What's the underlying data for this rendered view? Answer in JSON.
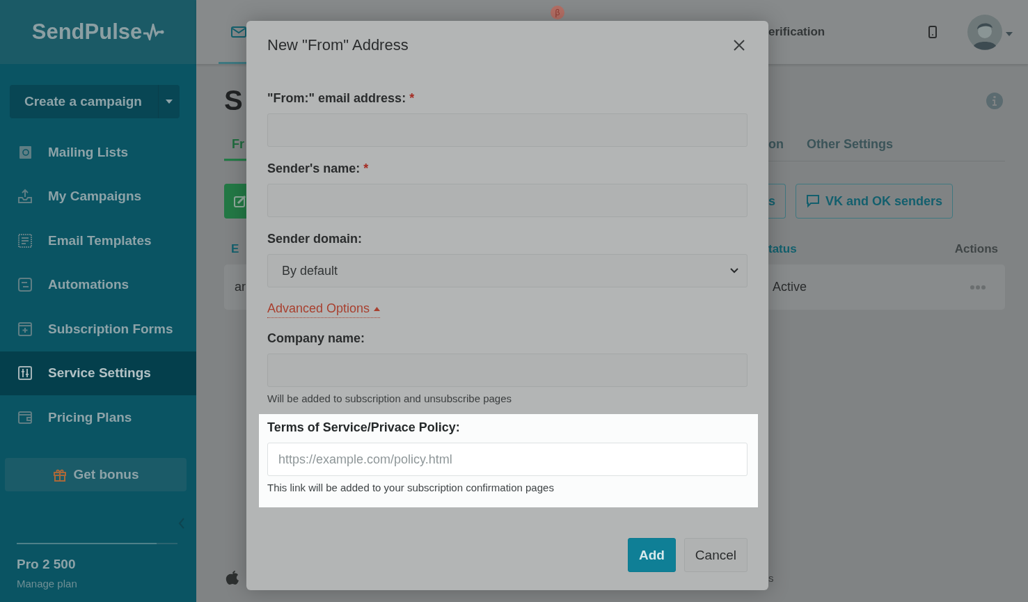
{
  "sidebar": {
    "logo": "SendPulse",
    "create_button": "Create a campaign",
    "items": [
      {
        "label": "Mailing Lists",
        "selected": false
      },
      {
        "label": "My Campaigns",
        "selected": false
      },
      {
        "label": "Email Templates",
        "selected": false
      },
      {
        "label": "Automations",
        "selected": false
      },
      {
        "label": "Subscription Forms",
        "selected": false
      },
      {
        "label": "Service Settings",
        "selected": true
      },
      {
        "label": "Pricing Plans",
        "selected": false
      }
    ],
    "bonus_button": "Get bonus",
    "plan": {
      "name": "Pro 2 500",
      "link": "Manage plan",
      "level": 0.87
    }
  },
  "topbar": {
    "badge": "β",
    "tab_fragment": "erification"
  },
  "page": {
    "title": "S",
    "tabs": [
      {
        "label": "Fr",
        "selected": true
      },
      {
        "label": "on",
        "selected": false
      },
      {
        "label": "Other Settings",
        "selected": false
      }
    ],
    "buttons": [
      "s",
      "VK and OK senders"
    ],
    "table": {
      "columns": [
        "E",
        "tatus",
        "Actions"
      ],
      "rows": [
        [
          "ar",
          "Active"
        ]
      ]
    },
    "footer_fragment": "s"
  },
  "modal": {
    "title": "New \"From\" Address",
    "fields": [
      {
        "kind": "input",
        "label": "\"From:\" email address:",
        "mark": "*"
      },
      {
        "kind": "input",
        "label": "Sender's name:",
        "mark": "*"
      },
      {
        "kind": "select",
        "label": "Sender domain:",
        "value": "By default"
      },
      {
        "kind": "toggle",
        "label": "Advanced Options",
        "expanded": true
      },
      {
        "kind": "input",
        "label": "Company name:",
        "hint": "Will be added to subscription and unsubscribe pages"
      },
      {
        "kind": "input",
        "label": "Terms of Service/Privace Policy:",
        "placeholder": "https://example.com/policy.html",
        "hint": "This link will be added to your subscription confirmation pages",
        "highlighted": true
      }
    ],
    "buttons": [
      {
        "label": "Add",
        "kind": "primary"
      },
      {
        "label": "Cancel",
        "kind": "secondary"
      }
    ]
  }
}
